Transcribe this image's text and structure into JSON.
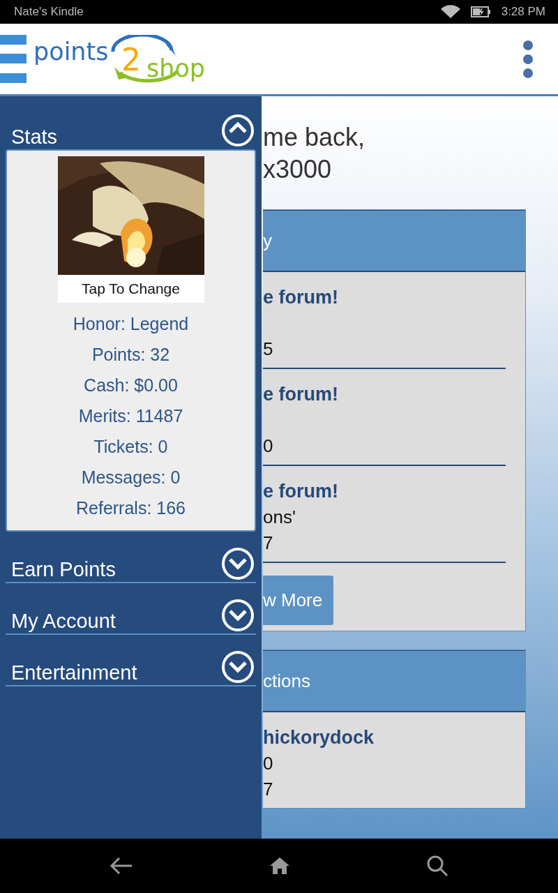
{
  "status_bar": {
    "device_name": "Nate's Kindle",
    "time": "3:28 PM"
  },
  "header": {
    "logo": [
      "points",
      "2",
      "shop"
    ]
  },
  "main": {
    "greeting_lines": [
      "me back,",
      "x3000"
    ],
    "cards": [
      {
        "title": "y",
        "items": [
          {
            "title": "e forum!",
            "value": "5"
          },
          {
            "title": "e forum!",
            "value": "0"
          },
          {
            "title": "e forum!",
            "detail": "ons'",
            "value": "7"
          }
        ],
        "button": "w More"
      },
      {
        "title": "ctions",
        "items": [
          {
            "title": "hickorydock",
            "detail": "0",
            "value": "7"
          }
        ]
      }
    ]
  },
  "drawer": {
    "sections": [
      {
        "title": "Stats",
        "expanded": true,
        "stats": {
          "caption": "Tap To Change",
          "lines": [
            "Honor: Legend",
            "Points: 32",
            "Cash: $0.00",
            "Merits: 11487",
            "Tickets: 0",
            "Messages: 0",
            "Referrals: 166"
          ]
        }
      },
      {
        "title": "Earn Points",
        "expanded": false
      },
      {
        "title": "My Account",
        "expanded": false
      },
      {
        "title": "Entertainment",
        "expanded": false
      }
    ]
  }
}
